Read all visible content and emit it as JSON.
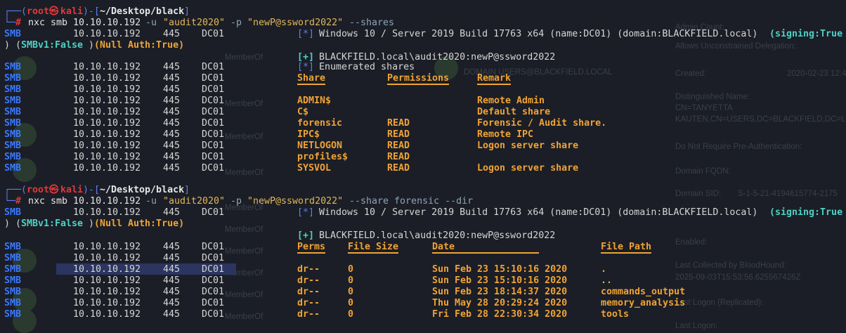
{
  "background_panel": {
    "labels": [
      "Admin Count:",
      "Allows Unconstrained Delegation:",
      "MemberOf",
      "MemberOf",
      "Created:",
      "2020-02-23 12:4",
      "Distinguished Name:",
      "CN=TANYETTA",
      "KAUTEN,CN=USERS,DC=BLACKFIELD,DC=LO",
      "Do Not Require Pre-Authentication:",
      "Domain FQDN:",
      "Domain SID:",
      "S-1-5-21-4194615774-2175",
      "Enabled:",
      "Last Collected by BloodHound:",
      "2025-09-03T15:53:56.625567426Z",
      "Last Logon (Replicated):",
      "Last Logon:",
      "DOMAIN USERS@BLACKFIELD.LOCAL",
      "MemberOf",
      "MemberOf",
      "MemberOf",
      "MemberOf",
      "MemberOf",
      "MemberOf",
      "MemberOf",
      "MemberOf"
    ]
  },
  "block1": {
    "prompt": {
      "user": "root",
      "skull": "㉿",
      "host": "kali",
      "path": "~/Desktop/black"
    },
    "command": {
      "cmd": "nxc smb 10.10.10.192",
      "u_flag": "-u",
      "user": "\"audit2020\"",
      "p_flag": "-p",
      "pass": "\"newP@ssword2022\"",
      "extra": "--shares"
    },
    "info_line": "Windows 10 / Server 2019 Build 17763 x64 (name:DC01) (domain:BLACKFIELD.local)",
    "signing": "(signing:True",
    "wrap": ") (SMBv1:False) (Null Auth:True)",
    "auth": "BLACKFIELD.local\\audit2020:newP@ssword2022",
    "enum": "Enumerated shares",
    "headers": [
      "Share",
      "Permissions",
      "Remark"
    ],
    "rows": [
      [
        "ADMIN$",
        "",
        "Remote Admin"
      ],
      [
        "C$",
        "",
        "Default share"
      ],
      [
        "forensic",
        "READ",
        "Forensic / Audit share."
      ],
      [
        "IPC$",
        "READ",
        "Remote IPC"
      ],
      [
        "NETLOGON",
        "READ",
        "Logon server share"
      ],
      [
        "profiles$",
        "READ",
        ""
      ],
      [
        "SYSVOL",
        "READ",
        "Logon server share"
      ]
    ]
  },
  "block2": {
    "prompt": {
      "user": "root",
      "skull": "㉿",
      "host": "kali",
      "path": "~/Desktop/black"
    },
    "command": {
      "cmd": "nxc smb 10.10.10.192",
      "u_flag": "-u",
      "user": "\"audit2020\"",
      "p_flag": "-p",
      "pass": "\"newP@ssword2022\"",
      "extra": "--share forensic --dir"
    },
    "info_line": "Windows 10 / Server 2019 Build 17763 x64 (name:DC01) (domain:BLACKFIELD.local)",
    "signing": "(signing:True",
    "wrap": ") (SMBv1:False) (Null Auth:True)",
    "auth": "BLACKFIELD.local\\audit2020:newP@ssword2022",
    "headers": [
      "Perms",
      "File Size",
      "Date",
      "File Path"
    ],
    "rows": [
      [
        "dr--",
        "0",
        "Sun Feb 23 15:10:16 2020",
        "."
      ],
      [
        "dr--",
        "0",
        "Sun Feb 23 15:10:16 2020",
        ".."
      ],
      [
        "dr--",
        "0",
        "Sun Feb 23 18:14:37 2020",
        "commands_output"
      ],
      [
        "dr--",
        "0",
        "Thu May 28 20:29:24 2020",
        "memory_analysis"
      ],
      [
        "dr--",
        "0",
        "Fri Feb 28 22:30:34 2020",
        "tools"
      ]
    ]
  },
  "smb": {
    "proto": "SMB",
    "ip": "10.10.10.192",
    "port": "445",
    "name": "DC01"
  },
  "markers": {
    "star": "[*]",
    "plus": "[+]"
  }
}
